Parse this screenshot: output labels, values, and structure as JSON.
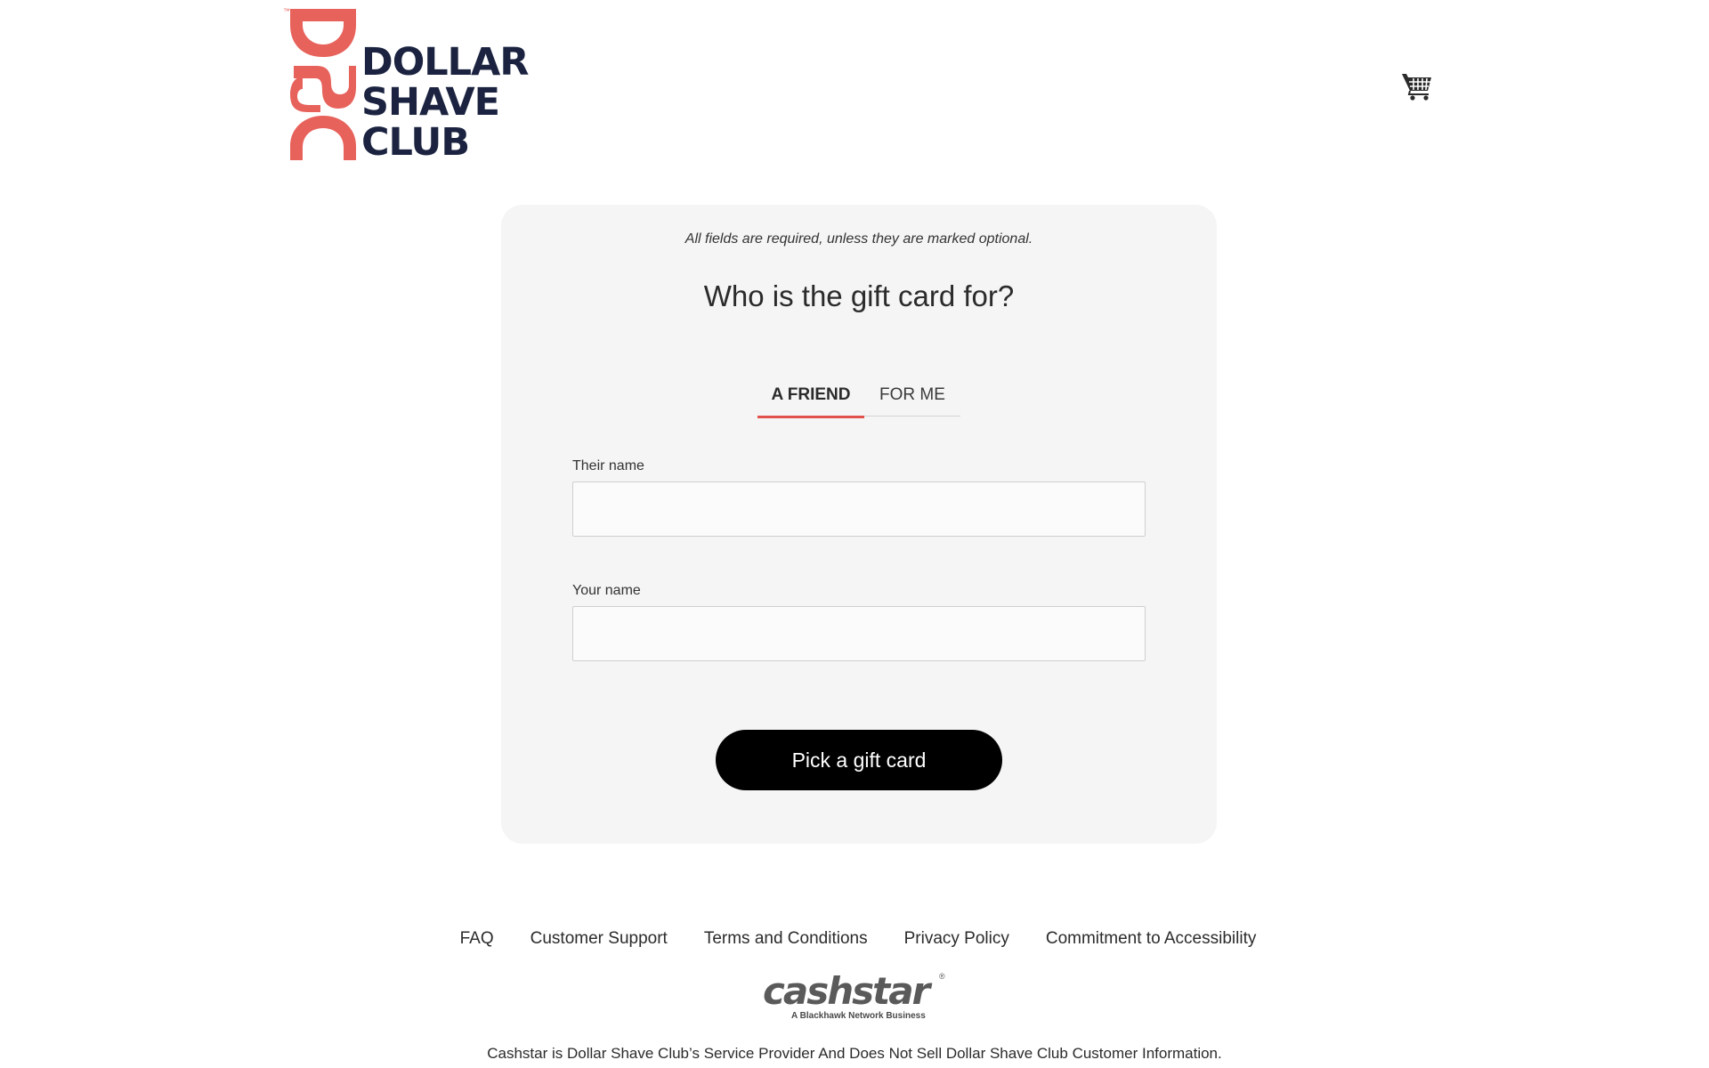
{
  "header": {
    "logo": {
      "monogram": "DSC",
      "trademark": "™",
      "lines": [
        "DOLLAR",
        "SHAVE",
        "CLUB"
      ]
    },
    "cart_icon": "shopping-cart-icon"
  },
  "form": {
    "required_note": "All fields are required, unless they are marked optional.",
    "title": "Who is the gift card for?",
    "tabs": [
      {
        "label": "A FRIEND",
        "active": true
      },
      {
        "label": "FOR ME",
        "active": false
      }
    ],
    "their_name": {
      "label": "Their name",
      "value": ""
    },
    "your_name": {
      "label": "Your name",
      "value": ""
    },
    "submit_label": "Pick a gift card"
  },
  "footer": {
    "links": [
      "FAQ",
      "Customer Support",
      "Terms and Conditions",
      "Privacy Policy",
      "Commitment to Accessibility"
    ],
    "brand": {
      "name": "cashstar",
      "registered": "®",
      "tagline": "A Blackhawk Network Business"
    },
    "disclaimer": "Cashstar is Dollar Shave Club’s Service Provider And Does Not Sell Dollar Shave Club Customer Information."
  },
  "colors": {
    "accent": "#e2514b",
    "logo_mark": "#e8625c",
    "logo_text": "#1b2340",
    "button_bg": "#000000",
    "card_bg": "#f5f5f5"
  }
}
